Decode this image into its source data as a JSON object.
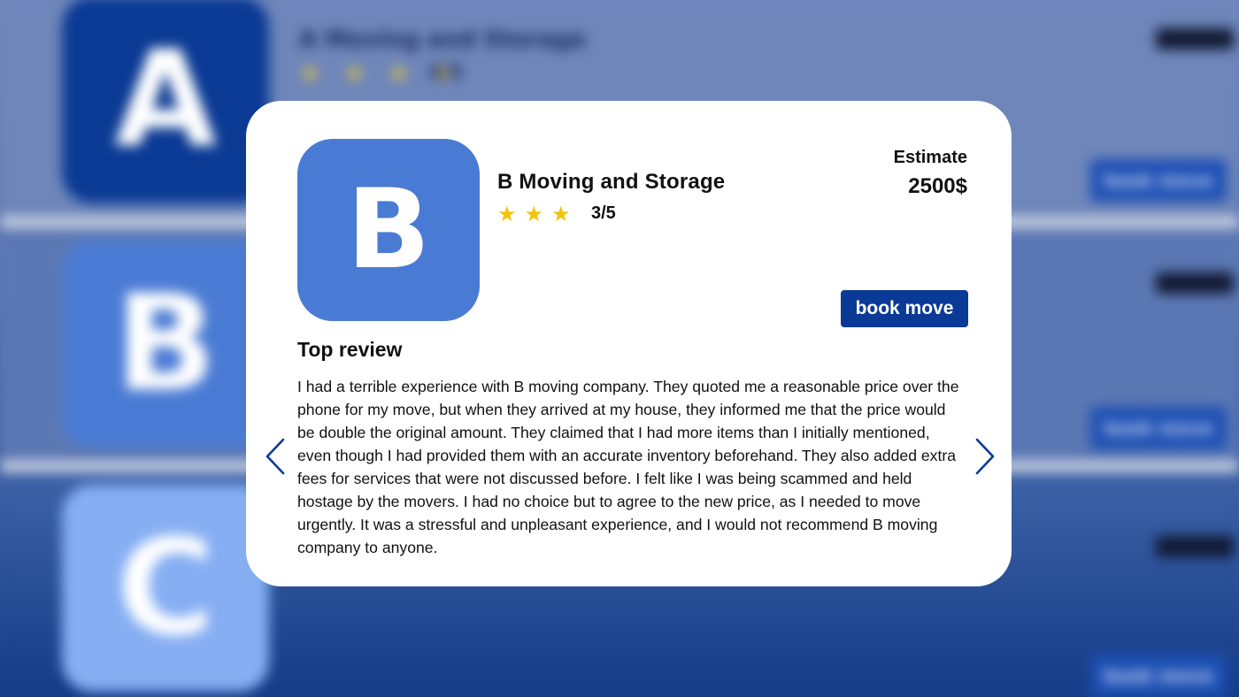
{
  "background_list": {
    "logos": [
      "A",
      "B",
      "C"
    ],
    "first_item": {
      "title": "A Moving and Storage",
      "stars": "★ ★ ★ ★",
      "rating": "4/5"
    },
    "book_label": "book move"
  },
  "modal": {
    "logo_letter": "B",
    "company_name": "B Moving and Storage",
    "stars": [
      "★",
      "★",
      "★"
    ],
    "rating": "3/5",
    "estimate_label": "Estimate",
    "estimate_value": "2500$",
    "book_button": "book move",
    "review_heading": "Top review",
    "review_text": "I had a terrible experience with B moving company. They quoted me a reasonable price over the phone for my move, but when they arrived at my house, they informed me that the price would be double the original amount. They claimed that I had more items than I initially mentioned, even though I had provided them with an accurate inventory beforehand. They also added extra fees for services that were not discussed before. I felt like I was being scammed and held hostage by the movers. I had no choice but to agree to the new price, as I needed to move urgently. It was a stressful and unpleasant experience, and I would not recommend B moving company to anyone.",
    "prev_icon": "chevron-left-icon",
    "next_icon": "chevron-right-icon"
  },
  "colors": {
    "brand_blue": "#0b3a96",
    "logo_b": "#4a7bd4",
    "star_gold": "#f4c20d"
  }
}
